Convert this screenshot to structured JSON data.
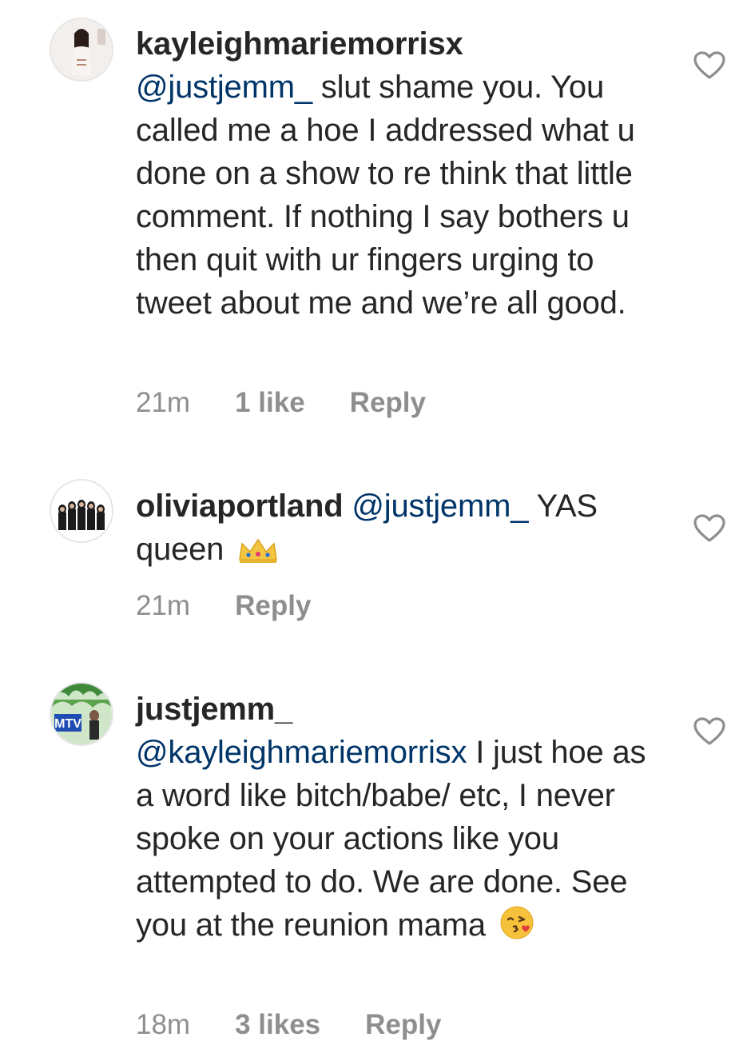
{
  "comments": [
    {
      "username": "kayleighmariemorrisx",
      "mention": "@justjemm_",
      "text": " slut shame you. You called me a hoe I addressed what u done on a show to re think that little comment. If nothing I say bothers u then quit with ur fingers urging to tweet about me and we’re all good.",
      "time": "21m",
      "likes": "1 like",
      "reply": "Reply"
    },
    {
      "username": "oliviaportland",
      "mention": "@justjemm_",
      "text": "  YAS queen ",
      "emoji": "crown-emoji",
      "time": "21m",
      "reply": "Reply"
    },
    {
      "username": "justjemm_",
      "mention": "@kayleighmariemorrisx",
      "text": " I just hoe as a word like bitch/babe/ etc, I never spoke on your actions like you attempted to do. We are done. See you at the reunion mama ",
      "emoji": "kissing-face-emoji",
      "avatar_badge": "MTV",
      "time": "18m",
      "likes": "3 likes",
      "reply": "Reply"
    }
  ],
  "colors": {
    "mention": "#003569",
    "meta": "#8e8e8e",
    "text": "#262626"
  }
}
